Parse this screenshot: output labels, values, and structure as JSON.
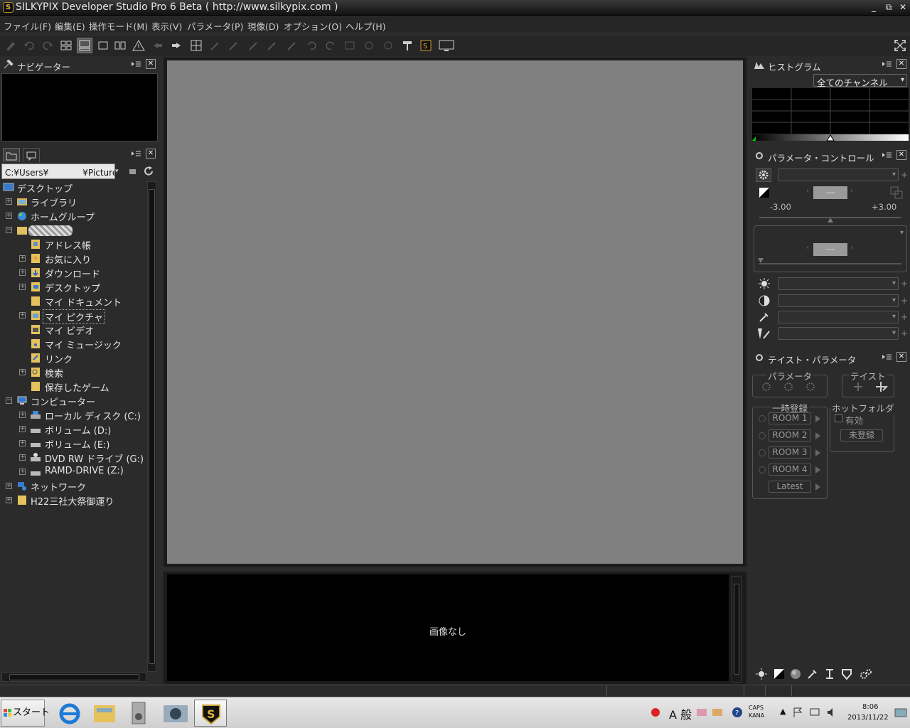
{
  "window": {
    "title": "SILKYPIX Developer Studio Pro 6 Beta ( http://www.silkypix.com )",
    "controls": [
      "_",
      "⧉",
      "✕"
    ]
  },
  "menu": [
    "ファイル(F)",
    "編集(E)",
    "操作モード(M)",
    "表示(V)",
    "パラメータ(P)",
    "現像(D)",
    "オプション(O)",
    "ヘルプ(H)"
  ],
  "navigator": {
    "title": "ナビゲーター"
  },
  "browser": {
    "path": "C:¥Users¥　　　　¥Picture",
    "tree": [
      {
        "label": "デスクトップ"
      },
      {
        "label": "ライブラリ"
      },
      {
        "label": "ホームグループ"
      },
      {
        "label": ""
      },
      {
        "label": "アドレス帳"
      },
      {
        "label": "お気に入り"
      },
      {
        "label": "ダウンロード"
      },
      {
        "label": "デスクトップ"
      },
      {
        "label": "マイ ドキュメント"
      },
      {
        "label": "マイ ピクチャ"
      },
      {
        "label": "マイ ビデオ"
      },
      {
        "label": "マイ ミュージック"
      },
      {
        "label": "リンク"
      },
      {
        "label": "検索"
      },
      {
        "label": "保存したゲーム"
      },
      {
        "label": "コンピューター"
      },
      {
        "label": "ローカル ディスク (C:)"
      },
      {
        "label": "ボリューム (D:)"
      },
      {
        "label": "ボリューム (E:)"
      },
      {
        "label": "DVD RW ドライブ (G:)"
      },
      {
        "label": "RAMD-DRIVE (Z:)"
      },
      {
        "label": "ネットワーク"
      },
      {
        "label": "H22三社大祭御運り"
      }
    ]
  },
  "filmstrip": {
    "empty_message": "画像なし"
  },
  "histogram": {
    "title": "ヒストグラム",
    "channel": "全てのチャンネル"
  },
  "param_control": {
    "title": "パラメータ・コントロール",
    "exposure_value": "---",
    "exposure_min": "-3.00",
    "exposure_max": "+3.00",
    "second_value": "---"
  },
  "taste": {
    "title": "テイスト・パラメータ",
    "param_group": "パラメータ",
    "taste_group": "テイスト",
    "temp_group": "一時登録",
    "rooms": [
      "ROOM 1",
      "ROOM 2",
      "ROOM 3",
      "ROOM 4",
      "Latest"
    ],
    "hotfolder_group": "ホットフォルダ",
    "enabled_label": "有効",
    "unregistered_label": "未登録"
  },
  "taskbar": {
    "start": "スタート",
    "ime_mode": "A 般",
    "caps": "CAPS",
    "kana": "KANA",
    "time": "8:06",
    "date": "2013/11/22"
  }
}
